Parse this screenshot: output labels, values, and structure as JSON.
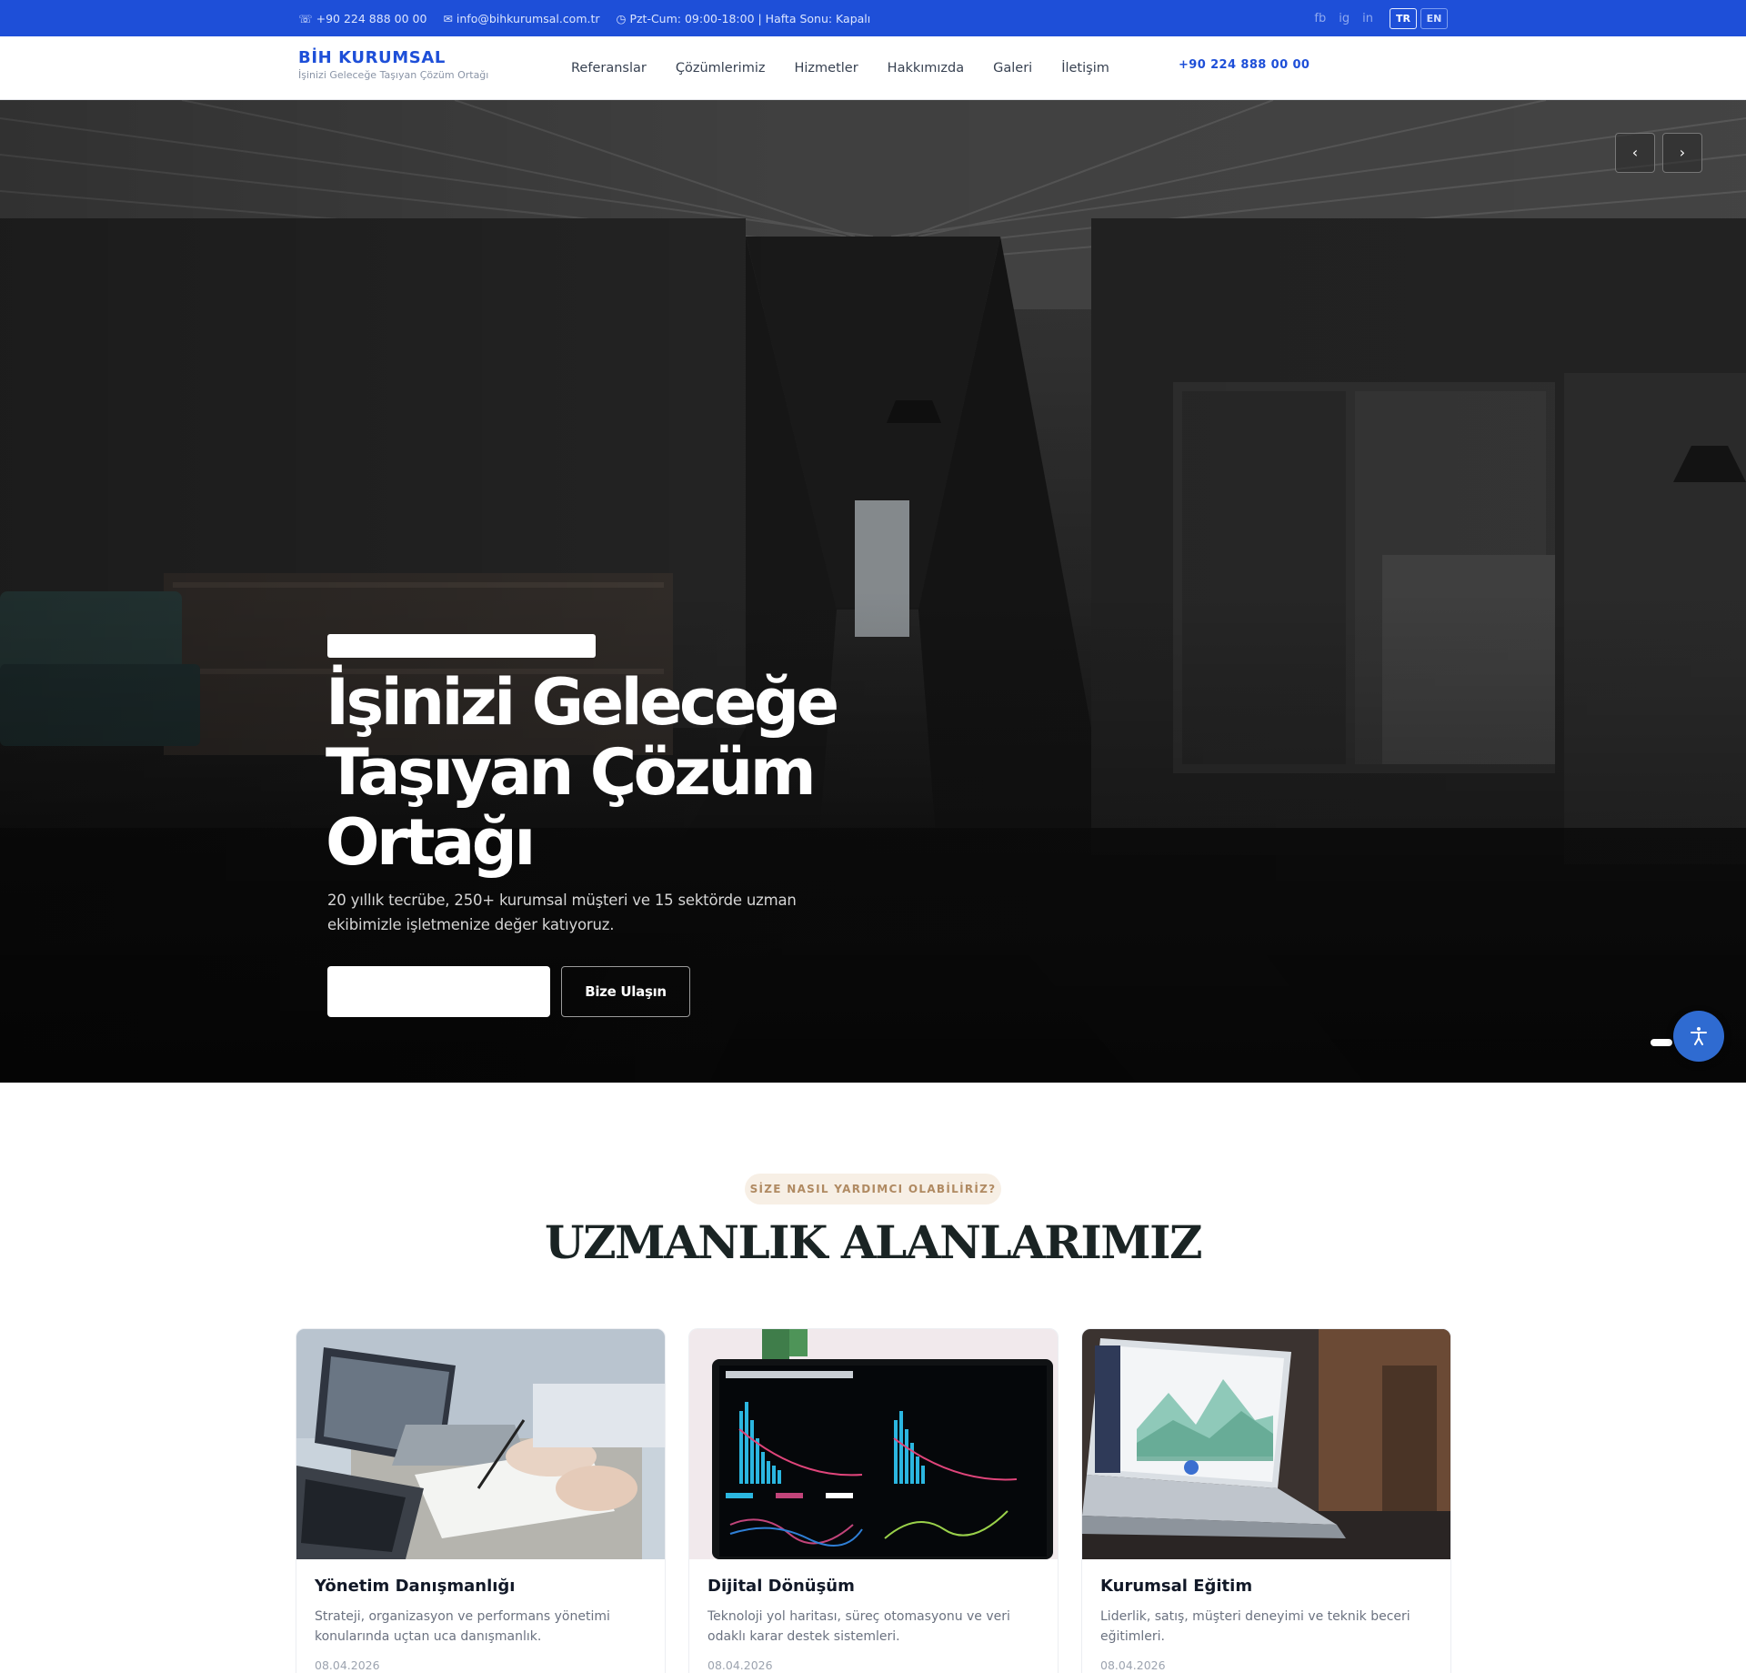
{
  "topbar": {
    "phone": "+90 224 888 00 00",
    "email": "info@bihkurumsal.com.tr",
    "hours": "Pzt-Cum: 09:00-18:00 | Hafta Sonu: Kapalı",
    "phone_icon": "phone-icon",
    "email_icon": "mail-icon",
    "hours_icon": "clock-icon",
    "social": [
      "fb",
      "ig",
      "in"
    ],
    "languages": [
      {
        "code": "TR",
        "active": true
      },
      {
        "code": "EN",
        "active": false
      }
    ]
  },
  "header": {
    "brand": "BİH KURUMSAL",
    "tagline": "İşinizi Geleceğe Taşıyan Çözüm Ortağı",
    "nav": [
      "Referanslar",
      "Çözümlerimiz",
      "Hizmetler",
      "Hakkımızda",
      "Galeri",
      "İletişim"
    ],
    "phone": "+90 224 888 00 00"
  },
  "hero": {
    "title": "İşinizi Geleceğe Taşıyan Çözüm Ortağı",
    "subtitle": "20 yıllık tecrübe, 250+ kurumsal müşteri ve 15 sektörde uzman ekibimizle işletmenize değer katıyoruz.",
    "primary_button": "",
    "secondary_button": "Bize Ulaşın",
    "prev_icon": "‹",
    "next_icon": "›",
    "slide_count": 3,
    "active_slide": 1
  },
  "services": {
    "eyebrow": "SİZE NASIL YARDIMCI OLABİLİRİZ?",
    "title": "UZMANLIK ALANLARIMIZ",
    "cards": [
      {
        "title": "Yönetim Danışmanlığı",
        "description": "Strateji, organizasyon ve performans yönetimi konularında uçtan uca danışmanlık.",
        "date": "08.04.2026"
      },
      {
        "title": "Dijital Dönüşüm",
        "description": "Teknoloji yol haritası, süreç otomasyonu ve veri odaklı karar destek sistemleri.",
        "date": "08.04.2026"
      },
      {
        "title": "Kurumsal Eğitim",
        "description": "Liderlik, satış, müşteri deneyimi ve teknik beceri eğitimleri.",
        "date": "08.04.2026"
      }
    ]
  },
  "colors": {
    "brand_blue": "#1e4fd8",
    "accessibility_blue": "#2f6bd1",
    "eyebrow_bg": "#f7efe5",
    "eyebrow_text": "#b08a62"
  }
}
